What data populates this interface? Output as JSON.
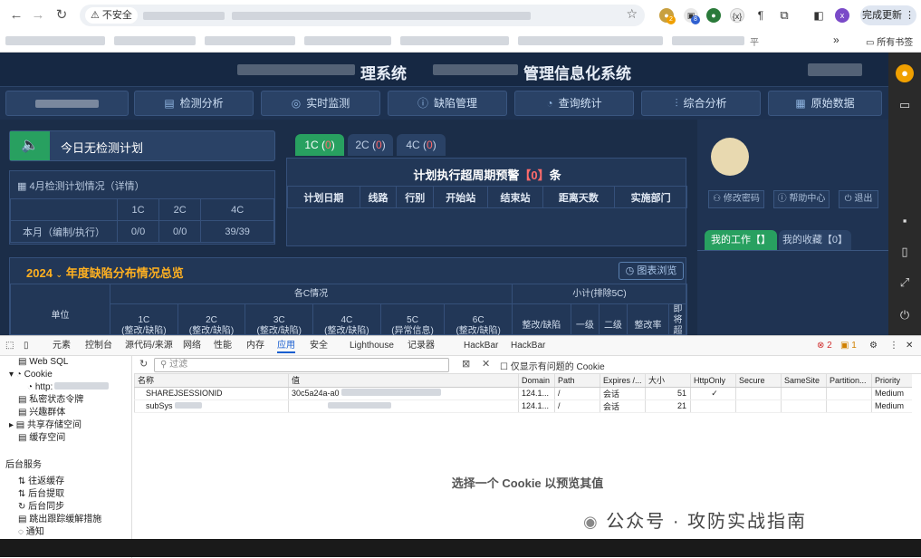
{
  "browser": {
    "security_label": "不安全",
    "update_button": "完成更新",
    "bookmarks_label": "所有书签",
    "bookmark_fragment": "平",
    "ext_badge_1": "2",
    "ext_badge_2": "8",
    "profile_initial": "x"
  },
  "app": {
    "title_left": "理系统",
    "title_right": "管理信息化系统",
    "menu": [
      {
        "label": "检测分析",
        "icon": "chart-icon"
      },
      {
        "label": "实时监测",
        "icon": "monitor-icon"
      },
      {
        "label": "缺陷管理",
        "icon": "info-icon"
      },
      {
        "label": "查询统计",
        "icon": "pie-icon"
      },
      {
        "label": "综合分析",
        "icon": "sliders-icon"
      },
      {
        "label": "原始数据",
        "icon": "doc-icon"
      }
    ],
    "plan_today": "今日无检测计划",
    "month_plan": {
      "heading": "4月检测计划情况（详情）",
      "columns": [
        "",
        "1C",
        "2C",
        "4C"
      ],
      "row_label": "本月（编制/执行）",
      "values": [
        "0/0",
        "0/0",
        "39/39"
      ]
    },
    "tabs": [
      {
        "label": "1C",
        "count": "0"
      },
      {
        "label": "2C",
        "count": "0"
      },
      {
        "label": "4C",
        "count": "0"
      }
    ],
    "warning": {
      "title_prefix": "计划执行超周期预警",
      "count": "【0】",
      "title_suffix": "条",
      "columns": [
        "计划日期",
        "线路",
        "行别",
        "开始站",
        "结束站",
        "距离天数",
        "实施部门"
      ]
    },
    "overview": {
      "year": "2024",
      "title": "年度缺陷分布情况总览",
      "chart_button": "图表浏览",
      "unit_label": "单位",
      "group_c": "各C情况",
      "group_sub": "小计(排除5C)",
      "sub_columns": [
        {
          "l1": "1C",
          "l2": "(整改/缺陷)"
        },
        {
          "l1": "2C",
          "l2": "(整改/缺陷)"
        },
        {
          "l1": "3C",
          "l2": "(整改/缺陷)"
        },
        {
          "l1": "4C",
          "l2": "(整改/缺陷)"
        },
        {
          "l1": "5C",
          "l2": "(异常信息)"
        },
        {
          "l1": "6C",
          "l2": "(整改/缺陷)"
        }
      ],
      "sub_totals": [
        "整改/缺陷",
        "一级",
        "二级",
        "整改率",
        "即将超期"
      ]
    },
    "user": {
      "change_password": "修改密码",
      "help": "帮助中心",
      "logout": "退出",
      "my_work": "我的工作【】",
      "my_fav": "我的收藏【0】"
    }
  },
  "devtools": {
    "tabs": [
      "元素",
      "控制台",
      "源代码/来源",
      "网络",
      "性能",
      "内存",
      "应用",
      "安全",
      "Lighthouse",
      "记录器",
      "HackBar",
      "HackBar"
    ],
    "active_tab": "应用",
    "errors": "2",
    "warnings": "1",
    "sidebar": [
      {
        "label": "Web SQL",
        "indent": 0
      },
      {
        "label": "Cookie",
        "indent": 0
      },
      {
        "label": "http:",
        "indent": 1
      },
      {
        "label": "私密状态令牌",
        "indent": 0
      },
      {
        "label": "兴趣群体",
        "indent": 0
      },
      {
        "label": "共享存储空间",
        "indent": 0
      },
      {
        "label": "缓存空间",
        "indent": 0
      }
    ],
    "section_backend": "后台服务",
    "backend_items": [
      "往返缓存",
      "后台提取",
      "后台同步",
      "跳出跟踪缓解措施",
      "通知"
    ],
    "filter_placeholder": "过滤",
    "only_issues": "仅显示有问题的 Cookie",
    "columns": [
      "名称",
      "值",
      "Domain",
      "Path",
      "Expires /...",
      "大小",
      "HttpOnly",
      "Secure",
      "SameSite",
      "Partition...",
      "Priority"
    ],
    "rows": [
      [
        "SHAREJSESSIONID",
        "30c5a24a-a0",
        "124.1...",
        "/",
        "会话",
        "51",
        "✓",
        "",
        "",
        "",
        "Medium"
      ],
      [
        "subSys",
        "",
        "124.1...",
        "/",
        "会话",
        "21",
        "",
        "",
        "",
        "",
        "Medium"
      ]
    ],
    "preview_text": "选择一个 Cookie 以预览其值",
    "watermark": "公众号 · 攻防实战指南"
  }
}
